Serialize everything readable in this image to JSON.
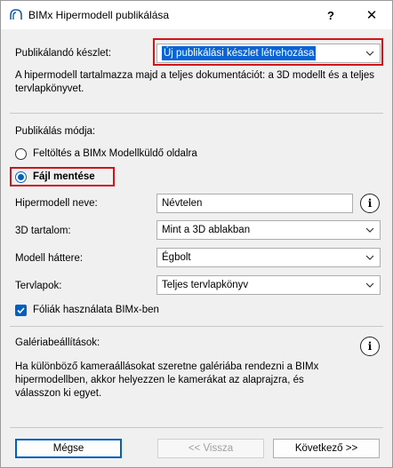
{
  "window": {
    "title": "BIMx Hipermodell publikálása",
    "help_label": "?",
    "close_label": "✕"
  },
  "publish_set": {
    "label": "Publikálandó készlet:",
    "value": "Új publikálási készlet létrehozása",
    "description": "A hipermodell tartalmazza majd a teljes dokumentációt: a 3D modellt és a teljes tervlapkönyvet."
  },
  "publish_mode": {
    "title": "Publikálás módja:",
    "options": [
      {
        "label": "Feltöltés a BIMx Modellküldő oldalra",
        "selected": false
      },
      {
        "label": "Fájl mentése",
        "selected": true
      }
    ]
  },
  "form": {
    "name_label": "Hipermodell neve:",
    "name_value": "Névtelen",
    "content_label": "3D tartalom:",
    "content_value": "Mint a 3D ablakban",
    "background_label": "Modell háttere:",
    "background_value": "Égbolt",
    "layouts_label": "Tervlapok:",
    "layouts_value": "Teljes tervlapkönyv",
    "layers_checkbox_label": "Fóliák használata BIMx-ben",
    "layers_checked": true
  },
  "gallery": {
    "title": "Galériabeállítások:",
    "description": "Ha különböző kameraállásokat szeretne galériába rendezni a BIMx hipermodellben, akkor helyezzen le kamerákat az alaprajzra, és válasszon ki egyet."
  },
  "buttons": {
    "cancel": "Mégse",
    "back": "<< Vissza",
    "next": "Következő >>"
  },
  "colors": {
    "accent": "#0060c0",
    "highlight": "#0a64d8",
    "annotation_red": "#d0141c"
  }
}
